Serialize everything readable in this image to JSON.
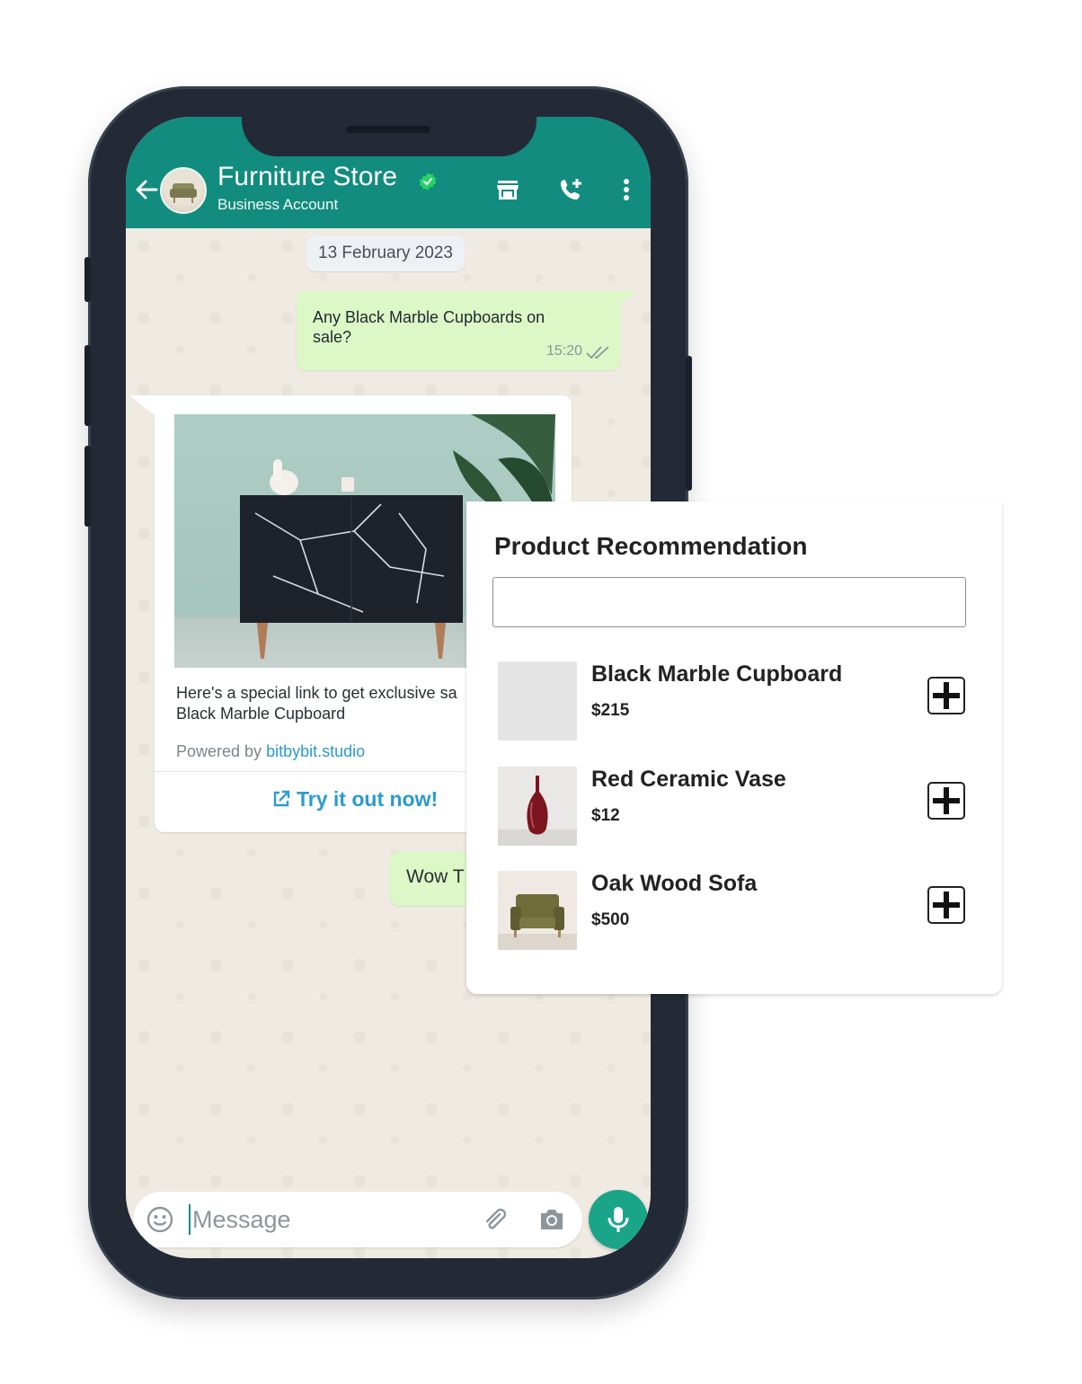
{
  "header": {
    "store_name": "Furniture Store",
    "account_type": "Business Account",
    "accent_color": "#128c7e",
    "icons": [
      "back-arrow-icon",
      "verified-badge-icon",
      "store-icon",
      "add-call-icon",
      "more-options-icon"
    ]
  },
  "chat": {
    "date": "13 February 2023",
    "messages": [
      {
        "type": "outgoing",
        "text": "Any Black Marble Cupboards on sale?",
        "time": "15:20",
        "status": "read"
      },
      {
        "type": "incoming-card",
        "text": "Here's a special link to get exclusive sa... Black Marble Cupboard",
        "text_line1": "Here's a special link to get exclusive sa",
        "text_line2": "Black Marble Cupboard",
        "powered_prefix": "Powered by",
        "powered_link": "bitbybit.studio",
        "cta_label": "Try it out now!"
      },
      {
        "type": "outgoing",
        "text": "Wow T"
      }
    ]
  },
  "input": {
    "placeholder": "Message"
  },
  "recommendation": {
    "title": "Product Recommendation",
    "search_value": "",
    "products": [
      {
        "name": "Black Marble Cupboard",
        "price": "$215",
        "thumb": "placeholder"
      },
      {
        "name": "Red Ceramic Vase",
        "price": "$12",
        "thumb": "vase"
      },
      {
        "name": "Oak Wood Sofa",
        "price": "$500",
        "thumb": "sofa"
      }
    ]
  }
}
